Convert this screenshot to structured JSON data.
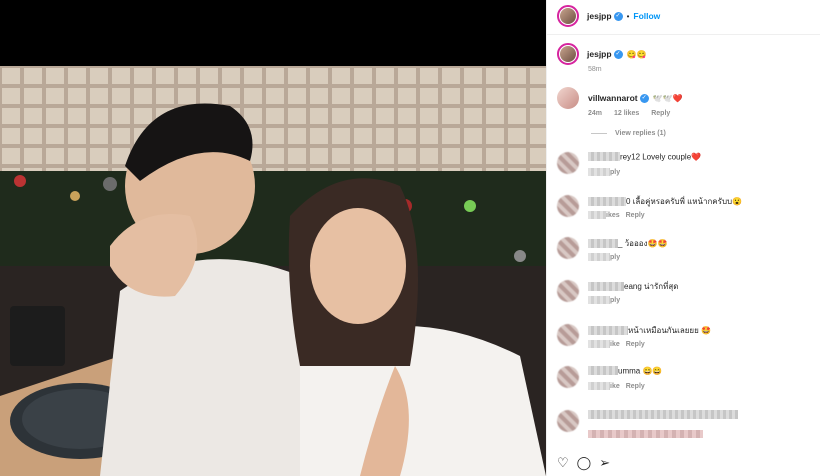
{
  "header": {
    "username": "jesjpp",
    "follow": "Follow"
  },
  "caption": {
    "username": "jesjpp",
    "text": "😋😋",
    "time": "58m"
  },
  "comments": [
    {
      "username": "villwannarot",
      "text": "🕊️🕊️❤️",
      "time": "24m",
      "likes": "12 likes",
      "reply": "Reply",
      "view_replies": "View replies (1)"
    },
    {
      "text": "rey12 Lovely couple❤️",
      "meta": "ply"
    },
    {
      "text": "0 เลื้อคู่หรอครับพี่ แหน้ากครับบ😮",
      "meta": "ikes",
      "reply": "Reply"
    },
    {
      "text": "_ ว้อออง🤩🤩",
      "meta": "ply"
    },
    {
      "text": "eang น่ารักที่สุด",
      "meta": "ply"
    },
    {
      "text": "หน้าเหมือนกันเลยยย 🤩",
      "meta": "ike",
      "reply": "Reply"
    },
    {
      "text": "umma 😄😄",
      "meta": "ike",
      "reply": "Reply"
    }
  ],
  "icons": [
    "heart-icon",
    "comment-icon",
    "share-icon"
  ],
  "colors": {
    "accent": "#0095f6",
    "verified": "#3897f0",
    "muted": "#8e8e8e"
  }
}
